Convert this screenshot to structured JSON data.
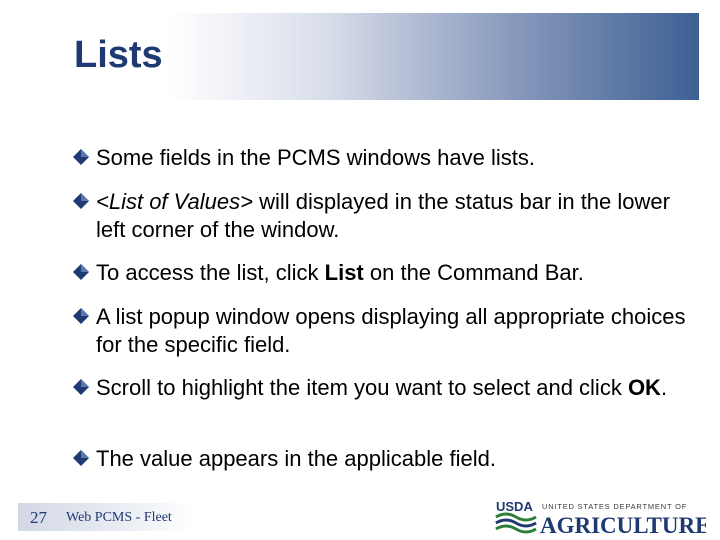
{
  "slide": {
    "title": "Lists"
  },
  "bullets": [
    {
      "text": "Some fields in the PCMS windows have lists."
    },
    {
      "italic": "<List of Values>",
      "text": " will displayed in the status bar in the lower left corner of the window."
    },
    {
      "pre": "To access the list, click ",
      "bold": "List",
      "post": " on the Command Bar."
    },
    {
      "text": "A list popup window opens displaying all appropriate choices for the specific field."
    },
    {
      "pre": "Scroll to highlight the item you want to select and click ",
      "bold": "OK",
      "post": "."
    },
    {
      "text": "The value appears in the applicable field."
    }
  ],
  "footer": {
    "page_number": "27",
    "text": "Web PCMS - Fleet",
    "logo_short": "USDA",
    "logo_top": "UNITED STATES DEPARTMENT OF",
    "logo_main": "AGRICULTURE"
  },
  "colors": {
    "title": "#1f3a73",
    "bullet": "#1f3a73",
    "band_end": "#3d6094"
  },
  "icons": {
    "bullet_marker": "diamond-bullet-icon"
  }
}
